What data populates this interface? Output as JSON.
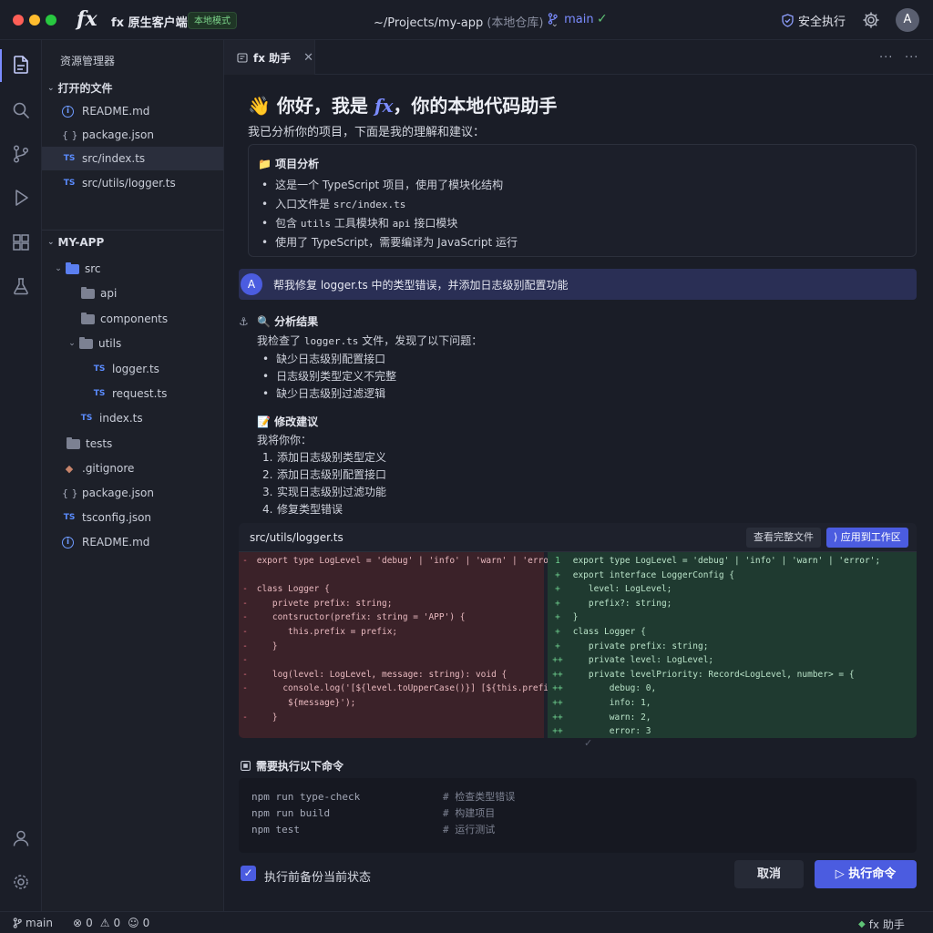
{
  "titlebar": {
    "logo": "fx",
    "app_name": "fx 原生客户端",
    "mode_badge": "本地模式",
    "project_path": "~/Projects/my-app",
    "project_path_sub": "(本地仓库)",
    "branch": "main",
    "secure_label": "安全执行",
    "avatar_initial": "A"
  },
  "sidebar": {
    "title": "资源管理器",
    "open_files_header": "打开的文件",
    "open_files": [
      {
        "name": "README.md",
        "icon": "info-icon"
      },
      {
        "name": "package.json",
        "icon": "json-icon"
      },
      {
        "name": "src/index.ts",
        "icon": "ts-icon",
        "selected": true
      },
      {
        "name": "src/utils/logger.ts",
        "icon": "ts-icon"
      }
    ],
    "project_header": "MY-APP",
    "tree": {
      "src": "src",
      "api": "api",
      "components": "components",
      "utils": "utils",
      "logger": "logger.ts",
      "request": "request.ts",
      "index": "index.ts",
      "tests": "tests",
      "gitignore": ".gitignore",
      "package": "package.json",
      "tsconfig": "tsconfig.json",
      "readme": "README.md"
    },
    "ts_label": "TS",
    "json_label": "{ }",
    "info_label": "i"
  },
  "tab": {
    "label": "fx 助手",
    "close": "✕",
    "more": "···"
  },
  "chat": {
    "greeting_prefix": "你好，我是 ",
    "greeting_fx": "fx",
    "greeting_suffix": "，你的本地代码助手",
    "intro": "我已分析你的项目，下面是我的理解和建议：",
    "analysis_title": "项目分析",
    "analysis_items": [
      "这是一个 TypeScript 项目，使用了模块化结构",
      "入口文件是 ",
      "包含 ",
      "使用了 TypeScript，需要编译为 JavaScript 运行"
    ],
    "entry_file": "src/index.ts",
    "modules_utils": "utils",
    "modules_mid": " 工具模块和 ",
    "modules_api": "api",
    "modules_end": " 接口模块",
    "user_initial": "A",
    "user_message": "帮我修复 logger.ts 中的类型错误，并添加日志级别配置功能",
    "result_title": "分析结果",
    "result_intro_a": "我检查了 ",
    "result_intro_file": "logger.ts",
    "result_intro_b": " 文件，发现了以下问题：",
    "issues": [
      "缺少日志级别配置接口",
      "日志级别类型定义不完整",
      "缺少日志级别过滤逻辑"
    ],
    "suggest_title": "修改建议",
    "suggest_intro": "我将你你：",
    "steps": [
      "添加日志级别类型定义",
      "添加日志级别配置接口",
      "实现日志级别过滤功能",
      "修复类型错误"
    ]
  },
  "diff": {
    "file": "src/utils/logger.ts",
    "view_full": "查看完整文件",
    "apply": "应用到工作区",
    "left": [
      {
        "m": "-",
        "c": " export type LogLevel = 'debug' | 'info' | 'warn' | 'error';"
      },
      {
        "m": "",
        "c": ""
      },
      {
        "m": "-",
        "c": " class Logger {"
      },
      {
        "m": "-",
        "c": "    privete prefix: string;"
      },
      {
        "m": "-",
        "c": "    contsructor(prefix: string = 'APP') {"
      },
      {
        "m": "-",
        "c": "       this.prefix = prefix;"
      },
      {
        "m": "-",
        "c": "    }"
      },
      {
        "m": "-",
        "c": ""
      },
      {
        "m": "-",
        "c": "    log(level: LogLevel, message: string): void {"
      },
      {
        "m": "-",
        "c": "      console.log('[${level.toUpperCase()}] [${this.prefix}]"
      },
      {
        "m": "",
        "c": "       ${message}');"
      },
      {
        "m": "-",
        "c": "    }"
      }
    ],
    "right": [
      {
        "m": "1",
        "c": " export type LogLevel = 'debug' | 'info' | 'warn' | 'error';"
      },
      {
        "m": "+",
        "c": " export interface LoggerConfig {"
      },
      {
        "m": "+",
        "c": "    level: LogLevel;"
      },
      {
        "m": "+",
        "c": "    prefix?: string;"
      },
      {
        "m": "+",
        "c": " }"
      },
      {
        "m": "+",
        "c": " class Logger {"
      },
      {
        "m": "+",
        "c": "    private prefix: string;"
      },
      {
        "m": "++",
        "c": "    private level: LogLevel;"
      },
      {
        "m": "++",
        "c": "    private levelPriority: Record<LogLevel, number> = {"
      },
      {
        "m": "++",
        "c": "        debug: 0,"
      },
      {
        "m": "++",
        "c": "        info: 1,"
      },
      {
        "m": "++",
        "c": "        warn: 2,"
      },
      {
        "m": "++",
        "c": "        error: 3"
      }
    ]
  },
  "commands": {
    "title": "需要执行以下命令",
    "lines": [
      {
        "cmd": "npm run type-check",
        "comment": "# 检查类型错误"
      },
      {
        "cmd": "npm run build",
        "comment": "# 构建项目"
      },
      {
        "cmd": "npm test",
        "comment": "# 运行测试"
      }
    ],
    "backup_label": "执行前备份当前状态",
    "backup_checked": true,
    "cancel": "取消",
    "run": "执行命令"
  },
  "statusbar": {
    "branch": "main",
    "errors": "0",
    "warnings": "0",
    "info": "0",
    "assistant": "fx 助手"
  },
  "colors": {
    "accent": "#4b5ce0",
    "accent_text": "#7b8cff",
    "success": "#5fc476",
    "deleted_bg": "#3b2229",
    "added_bg": "#1f3a30"
  }
}
